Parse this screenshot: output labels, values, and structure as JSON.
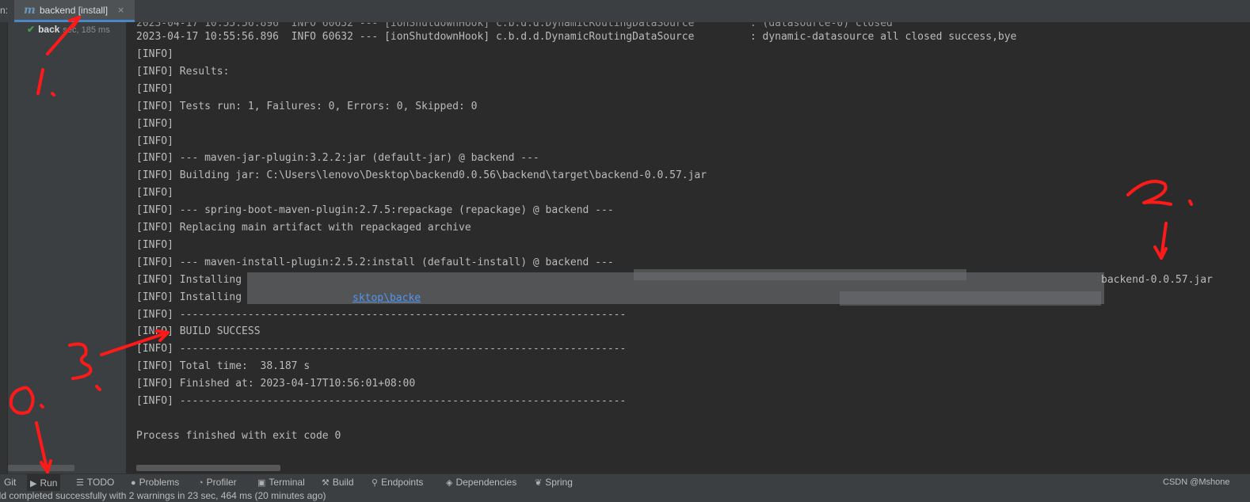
{
  "tabbar": {
    "prefix": "n:",
    "run_tab_label": "backend [install]",
    "close_glyph": "×",
    "m_icon": "m"
  },
  "tree": {
    "item_name": "back",
    "item_time": "sec, 185 ms"
  },
  "console": {
    "top_cut": "2023-04-17 10:55:56.896  INFO 60632 --- [ionShutdownHook] c.b.d.d.DynamicRoutingDataSource         : dynamic-datasource all closed success,bye",
    "lines": [
      "[INFO]",
      "[INFO] Results:",
      "[INFO]",
      "[INFO] Tests run: 1, Failures: 0, Errors: 0, Skipped: 0",
      "[INFO]",
      "[INFO]",
      "[INFO] --- maven-jar-plugin:3.2.2:jar (default-jar) @ backend ---",
      "[INFO] Building jar: C:\\Users\\lenovo\\Desktop\\backend0.0.56\\backend\\target\\backend-0.0.57.jar",
      "[INFO]",
      "[INFO] --- spring-boot-maven-plugin:2.7.5:repackage (repackage) @ backend ---",
      "[INFO] Replacing main artifact with repackaged archive",
      "[INFO]",
      "[INFO] --- maven-install-plugin:2.5.2:install (default-install) @ backend ---",
      "[INFO] Installing",
      "[INFO] Installing",
      "[INFO] ------------------------------------------------------------------------",
      "[INFO] BUILD SUCCESS",
      "[INFO] ------------------------------------------------------------------------",
      "[INFO] Total time:  38.187 s",
      "[INFO] Finished at: 2023-04-17T10:56:01+08:00",
      "[INFO] ------------------------------------------------------------------------",
      "",
      "Process finished with exit code 0"
    ],
    "installing_tail": "backend-0.0.57.jar",
    "installing_link_frag": "sktop\\backe"
  },
  "toolbar": {
    "items": [
      {
        "label": "Git",
        "icon": ""
      },
      {
        "label": "Run",
        "icon": "▶"
      },
      {
        "label": "TODO",
        "icon": "☰"
      },
      {
        "label": "Problems",
        "icon": "●"
      },
      {
        "label": "Profiler",
        "icon": "◔"
      },
      {
        "label": "Terminal",
        "icon": "▣"
      },
      {
        "label": "Build",
        "icon": "⚒"
      },
      {
        "label": "Endpoints",
        "icon": "⚲"
      },
      {
        "label": "Dependencies",
        "icon": "◈"
      },
      {
        "label": "Spring",
        "icon": "❦"
      }
    ],
    "credit": "CSDN @Mshone"
  },
  "statusbar": {
    "text": "ild completed successfully with 2 warnings in 23 sec, 464 ms (20 minutes ago)"
  },
  "annotations": {
    "marks": [
      "1.",
      "2.",
      "3.",
      "0."
    ],
    "color": "#ff1a1a"
  }
}
